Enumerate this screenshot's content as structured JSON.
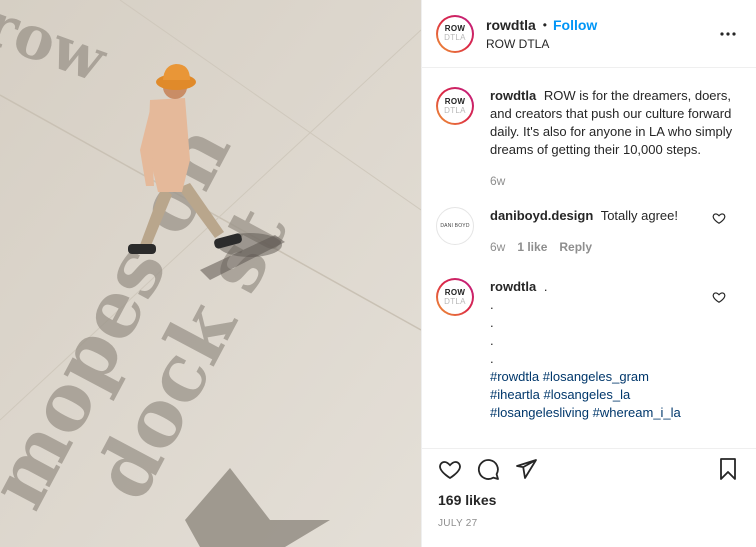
{
  "photo": {
    "alt": "",
    "ground_text_1": "mopes on",
    "ground_text_2": "dock st"
  },
  "header": {
    "avatar_line1": "ROW",
    "avatar_line2": "DTLA",
    "username": "rowdtla",
    "separator": "•",
    "follow_label": "Follow",
    "subtitle": "ROW DTLA"
  },
  "comments": [
    {
      "username": "rowdtla",
      "text": "ROW is for the dreamers, doers, and creators that push our culture forward daily. It's also for anyone in LA who simply dreams of getting their 10,000 steps.",
      "time": "6w"
    },
    {
      "username": "daniboyd.design",
      "avatar_text": "DANI BOYD",
      "text": "Totally agree!",
      "time": "6w",
      "likes": "1 like",
      "reply": "Reply"
    },
    {
      "username": "rowdtla",
      "text": ".",
      "dots": [
        ".",
        ".",
        ".",
        "."
      ],
      "hashtags_1": "#rowdtla #losangeles_gram",
      "hashtags_2": "#iheartla #losangeles_la",
      "hashtags_3": "#losangelesliving #wheream_i_la"
    }
  ],
  "actions": {
    "likes": "169 likes",
    "date": "JULY 27"
  },
  "icons": [
    "more-icon",
    "heart-icon",
    "comment-icon",
    "share-icon",
    "bookmark-icon"
  ],
  "colors": {
    "follow": "#0095f6",
    "text": "#262626",
    "muted": "#8e8e8e",
    "hashtag": "#00376b"
  }
}
